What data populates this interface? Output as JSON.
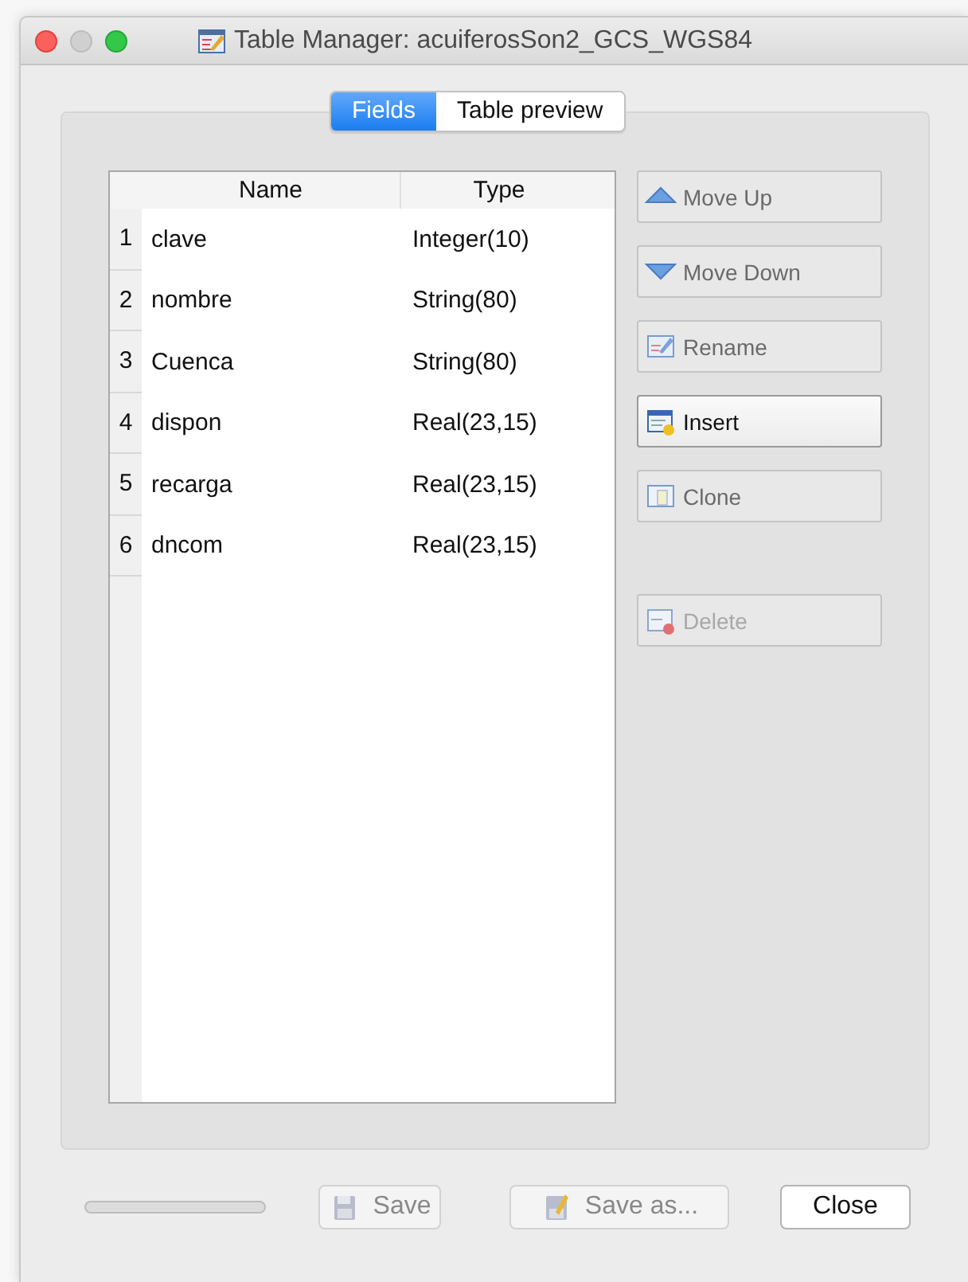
{
  "window": {
    "title": "Table Manager: acuiferosSon2_GCS_WGS84"
  },
  "tabs": [
    {
      "label": "Fields",
      "selected": true
    },
    {
      "label": "Table preview",
      "selected": false
    }
  ],
  "table": {
    "columns": [
      "Name",
      "Type"
    ],
    "rows": [
      {
        "number": "1",
        "name": "clave",
        "type": "Integer(10)"
      },
      {
        "number": "2",
        "name": "nombre",
        "type": "String(80)"
      },
      {
        "number": "3",
        "name": "Cuenca",
        "type": "String(80)"
      },
      {
        "number": "4",
        "name": "dispon",
        "type": "Real(23,15)"
      },
      {
        "number": "5",
        "name": "recarga",
        "type": "Real(23,15)"
      },
      {
        "number": "6",
        "name": "dncom",
        "type": "Real(23,15)"
      }
    ]
  },
  "side_buttons": [
    {
      "label": "Move Up",
      "kind": "up",
      "disabled": true
    },
    {
      "label": "Move Down",
      "kind": "down",
      "disabled": true
    },
    {
      "label": "Rename",
      "kind": "rename",
      "disabled": true
    },
    {
      "label": "Insert",
      "kind": "insert",
      "disabled": false
    },
    {
      "label": "Clone",
      "kind": "clone",
      "disabled": true
    },
    {
      "label": "Delete",
      "kind": "delete",
      "disabled": true
    }
  ],
  "progress": {
    "level": 0
  },
  "bottom_buttons": [
    {
      "label": "Save",
      "kind": "save",
      "disabled": true
    },
    {
      "label": "Save as...",
      "kind": "saveas",
      "disabled": true
    },
    {
      "label": "Close",
      "kind": "plain",
      "disabled": false
    }
  ]
}
